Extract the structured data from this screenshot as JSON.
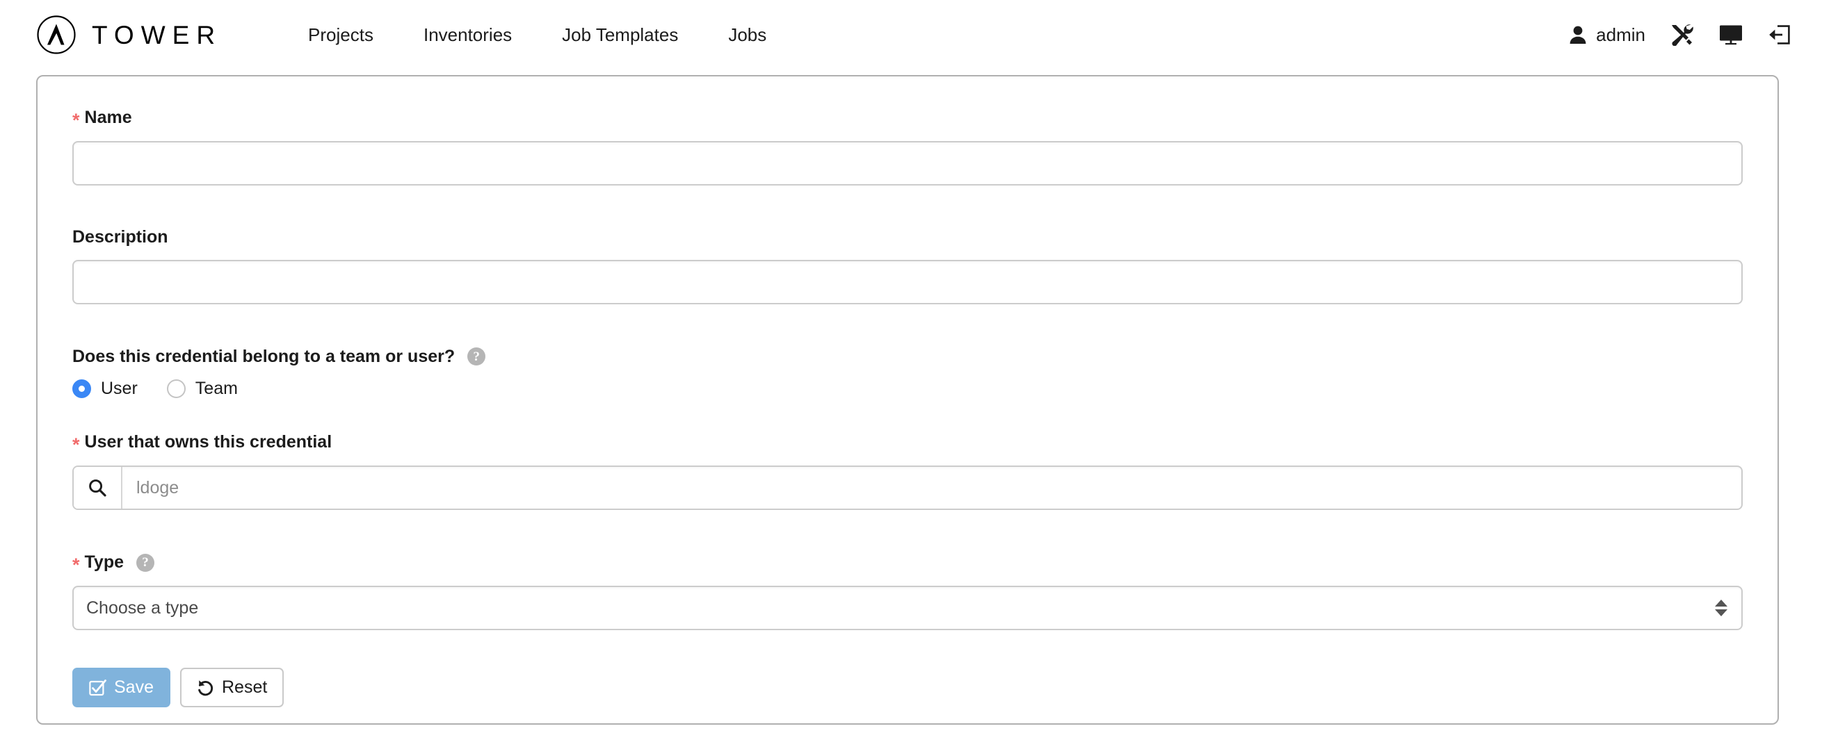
{
  "header": {
    "logo_icon": "ansible-tower-logo-icon",
    "brand": "TOWER",
    "nav": [
      {
        "label": "Projects",
        "name": "nav-projects"
      },
      {
        "label": "Inventories",
        "name": "nav-inventories"
      },
      {
        "label": "Job Templates",
        "name": "nav-job-templates"
      },
      {
        "label": "Jobs",
        "name": "nav-jobs"
      }
    ],
    "user": {
      "icon": "user-icon",
      "name": "admin"
    },
    "actions": [
      {
        "icon": "tools-icon",
        "name": "settings-tools-button"
      },
      {
        "icon": "monitor-icon",
        "name": "monitor-button"
      },
      {
        "icon": "logout-icon",
        "name": "logout-button"
      }
    ]
  },
  "form": {
    "name": {
      "label": "Name",
      "required_marker": "*",
      "value": "",
      "placeholder": ""
    },
    "description": {
      "label": "Description",
      "value": "",
      "placeholder": ""
    },
    "ownership": {
      "label": "Does this credential belong to a team or user?",
      "help_icon": "help-circle-icon",
      "options": [
        {
          "label": "User",
          "selected": true
        },
        {
          "label": "Team",
          "selected": false
        }
      ]
    },
    "owner": {
      "label": "User that owns this credential",
      "required_marker": "*",
      "search_icon": "search-icon",
      "value": "ldoge",
      "placeholder": "ldoge"
    },
    "type": {
      "label": "Type",
      "required_marker": "*",
      "help_icon": "help-circle-icon",
      "selected": "Choose a type",
      "options": [
        "Choose a type"
      ],
      "arrows_icon": "sort-updown-icon"
    },
    "buttons": {
      "save": {
        "label": "Save",
        "icon": "check-square-icon"
      },
      "reset": {
        "label": "Reset",
        "icon": "undo-arrow-icon"
      }
    }
  },
  "colors": {
    "save_button": "#80b3dc",
    "radio_selected": "#3a87f5",
    "required_asterisk": "#f16c6c",
    "panel_border": "#b0b0b0",
    "input_border": "#cccccc"
  }
}
